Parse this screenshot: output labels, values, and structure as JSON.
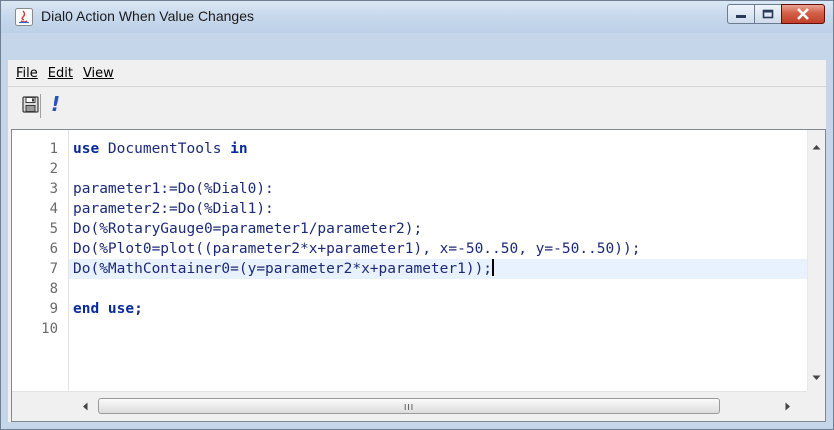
{
  "window": {
    "title": "Dial0 Action When Value Changes"
  },
  "menu": {
    "file": "File",
    "edit": "Edit",
    "view": "View"
  },
  "toolbar": {
    "save_icon": "save-icon",
    "execute_glyph": "!"
  },
  "editor": {
    "line_numbers": [
      "1",
      "2",
      "3",
      "4",
      "5",
      "6",
      "7",
      "8",
      "9",
      "10"
    ],
    "lines": {
      "l1_kw1": "use",
      "l1_txt": " DocumentTools ",
      "l1_kw2": "in",
      "l3": "parameter1:=Do(%Dial0):",
      "l4": "parameter2:=Do(%Dial1):",
      "l5": "Do(%RotaryGauge0=parameter1/parameter2);",
      "l6": "Do(%Plot0=plot((parameter2*x+parameter1), x=-50..50, y=-50..50));",
      "l7": "Do(%MathContainer0=(y=parameter2*x+parameter1));",
      "l9_kw": "end use",
      "l9_tail": ";"
    },
    "active_line": "7"
  },
  "scrollbar": {
    "grip": "III"
  },
  "colors": {
    "keyword": "#0a2a9c",
    "code_text": "#1d2a78",
    "active_line_bg": "#e8f2fe",
    "close_button": "#c0402a"
  }
}
